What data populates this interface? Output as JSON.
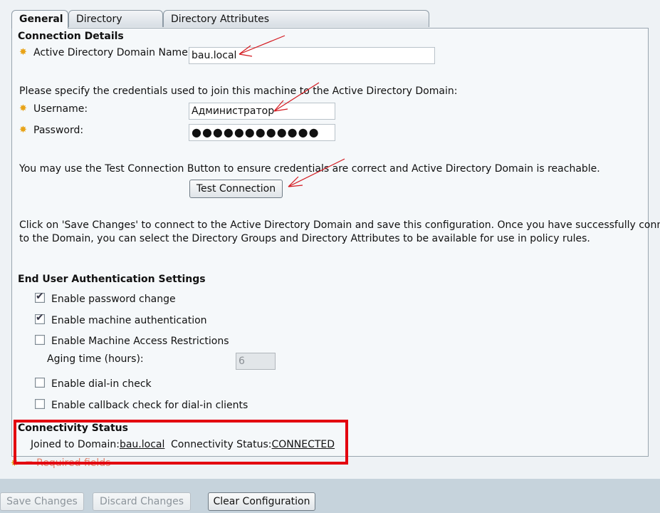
{
  "tabs": [
    {
      "label": "General",
      "active": true
    },
    {
      "label": "Directory Groups",
      "active": false
    },
    {
      "label": "Directory Attributes",
      "active": false
    }
  ],
  "connection": {
    "heading": "Connection Details",
    "domain_label": "Active Directory Domain Name:",
    "domain_value": "bau.local",
    "credentials_text": "Please specify the credentials used to join this machine to the Active Directory Domain:",
    "username_label": "Username:",
    "username_value": "Администратор",
    "password_label": "Password:",
    "password_value": "●●●●●●●●●●●●",
    "test_text": "You may use the Test Connection Button to ensure credentials are correct and Active Directory Domain is reachable.",
    "test_button": "Test Connection",
    "save_info_line1": "Click on 'Save Changes' to connect to the Active Directory Domain and save this configuration. Once you have successfully connected",
    "save_info_line2": "to the Domain, you can select the Directory Groups and Directory Attributes to be available for use in policy rules."
  },
  "auth": {
    "heading": "End User Authentication Settings",
    "options": [
      {
        "label": "Enable password change",
        "checked": true
      },
      {
        "label": "Enable machine authentication",
        "checked": true
      },
      {
        "label": "Enable Machine Access Restrictions",
        "checked": false
      },
      {
        "label": "Enable dial-in check",
        "checked": false
      },
      {
        "label": "Enable callback check for dial-in clients",
        "checked": false
      }
    ],
    "aging_label": "Aging time (hours):",
    "aging_value": "6"
  },
  "status": {
    "heading": "Connectivity Status",
    "joined_label": "Joined to Domain:",
    "joined_value": "bau.local",
    "status_label": "Connectivity Status:",
    "status_value": "CONNECTED"
  },
  "required_note": "= Required fields",
  "buttons": {
    "save": "Save Changes",
    "discard": "Discard Changes",
    "clear": "Clear Configuration"
  },
  "colors": {
    "required_icon": "#e8a317",
    "highlight_box": "#e3000f",
    "annotation_arrow": "#d4191f"
  }
}
